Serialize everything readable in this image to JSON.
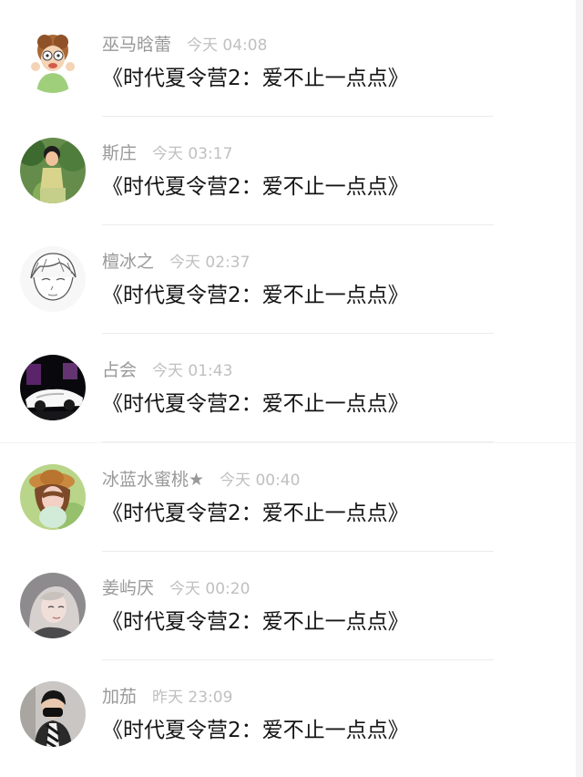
{
  "comments": [
    {
      "username": "巫马晗蕾",
      "time": "今天 04:08",
      "text": "《时代夏令营2：爱不止一点点》",
      "avatar_icon": "cartoon-avatar-icon"
    },
    {
      "username": "斯庄",
      "time": "今天 03:17",
      "text": "《时代夏令营2：爱不止一点点》",
      "avatar_icon": "child-photo-avatar-icon"
    },
    {
      "username": "檀冰之",
      "time": "今天 02:37",
      "text": "《时代夏令营2：爱不止一点点》",
      "avatar_icon": "sketch-avatar-icon"
    },
    {
      "username": "占会",
      "time": "今天 01:43",
      "text": "《时代夏令营2：爱不止一点点》",
      "avatar_icon": "car-avatar-icon"
    },
    {
      "username": "冰蓝水蜜桃★",
      "time": "今天 00:40",
      "text": "《时代夏令营2：爱不止一点点》",
      "avatar_icon": "girl-hat-avatar-icon"
    },
    {
      "username": "姜屿厌",
      "time": "今天 00:20",
      "text": "《时代夏令营2：爱不止一点点》",
      "avatar_icon": "portrait-avatar-icon"
    },
    {
      "username": "加茄",
      "time": "昨天 23:09",
      "text": "《时代夏令营2：爱不止一点点》",
      "avatar_icon": "masked-avatar-icon"
    }
  ]
}
